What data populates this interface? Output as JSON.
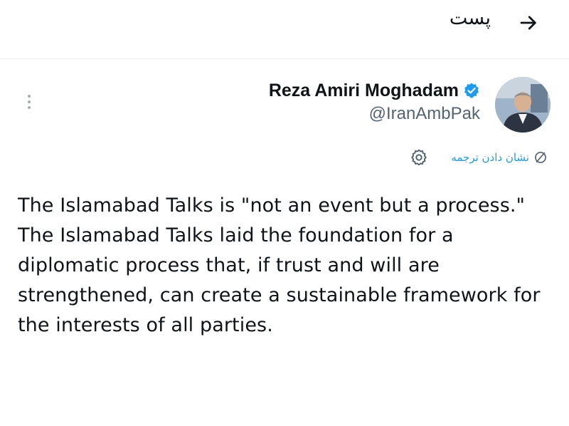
{
  "header": {
    "title": "پست",
    "back_icon": "arrow-right-icon"
  },
  "tweet": {
    "author_name": "Reza Amiri Moghadam",
    "author_handle": "@IranAmbPak",
    "verified_icon": "verified-badge-icon",
    "avatar_icon": "avatar-photo",
    "more_icon": "vertical-ellipsis-icon",
    "translate_label": "نشان دادن ترجمه",
    "translate_icon": "translate-icon",
    "settings_icon": "gear-icon",
    "body_paragraph_1": "The Islamabad Talks is \"not an event but a process.\"",
    "body_paragraph_2": "The Islamabad Talks laid the foundation for a diplomatic process that, if trust and will are strengthened, can create a sustainable framework for the interests of all parties."
  },
  "colors": {
    "accent": "#1d9bf0",
    "text": "#0f1419",
    "secondary_text": "#536471"
  }
}
